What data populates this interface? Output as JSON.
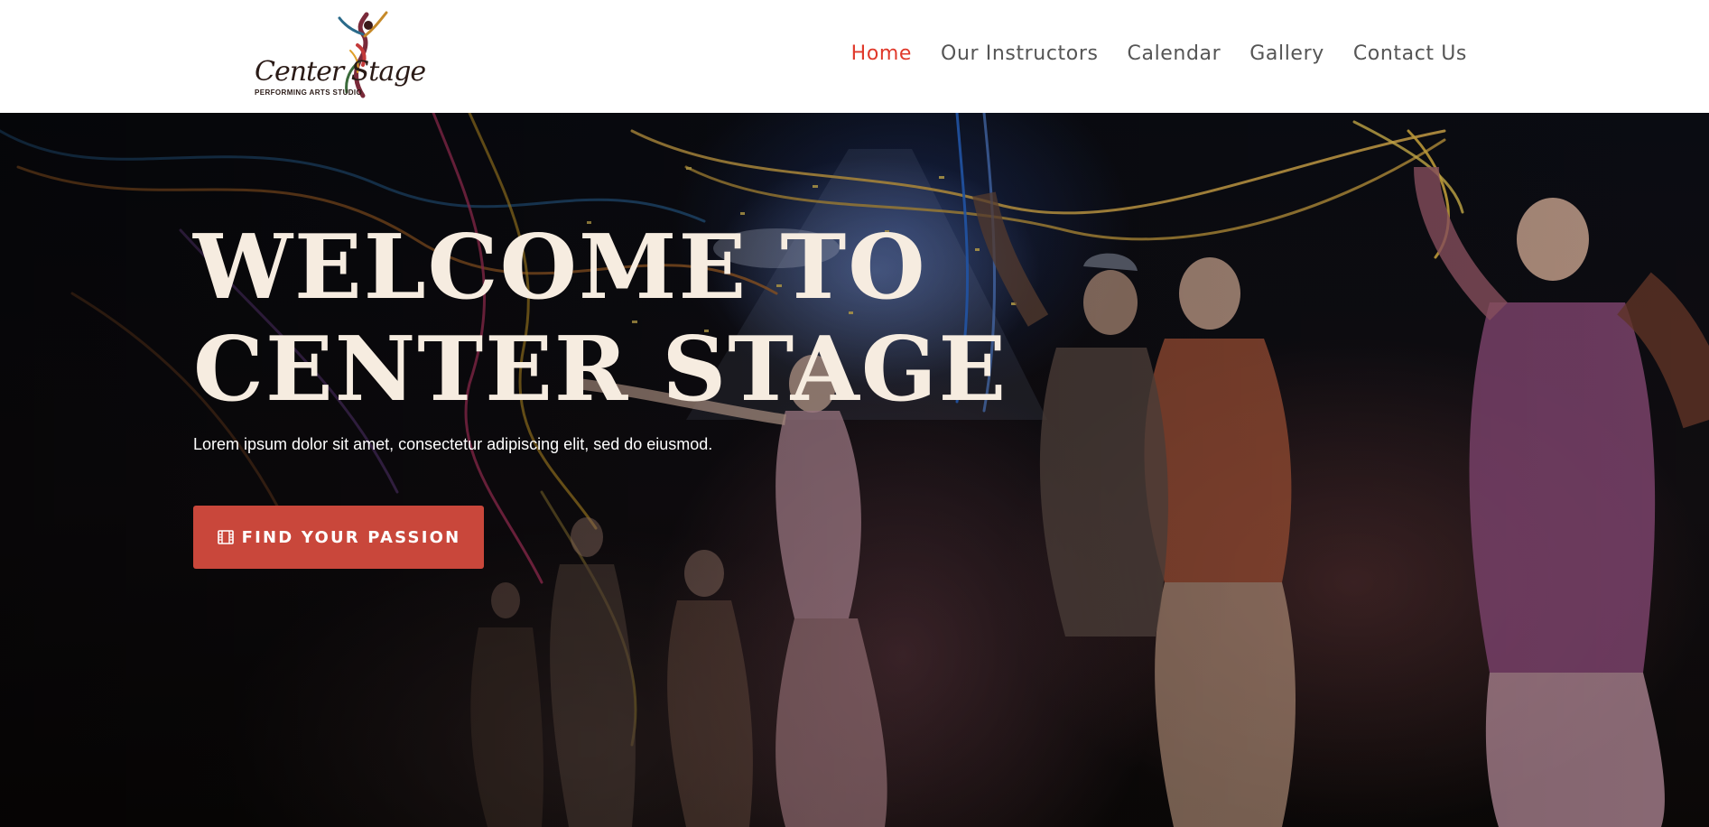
{
  "brand": {
    "logo_script": "Center Stage",
    "logo_sub": "PERFORMING ARTS STUDIO",
    "logo_icon": "dancer-logo-icon"
  },
  "nav": {
    "items": [
      {
        "label": "Home",
        "active": true
      },
      {
        "label": "Our Instructors",
        "active": false
      },
      {
        "label": "Calendar",
        "active": false
      },
      {
        "label": "Gallery",
        "active": false
      },
      {
        "label": "Contact Us",
        "active": false
      }
    ]
  },
  "hero": {
    "title": "WELCOME TO CENTER STAGE",
    "subtitle": "Lorem ipsum dolor sit amet, consectetur adipiscing elit, sed do eiusmod.",
    "cta_label": "FIND YOUR PASSION",
    "cta_icon": "film-icon",
    "background_description_icon": "stage-performance-photo"
  },
  "colors": {
    "accent": "#e0392b",
    "button": "#c9473b",
    "title": "#f6ece0",
    "nav_text": "#555555"
  }
}
